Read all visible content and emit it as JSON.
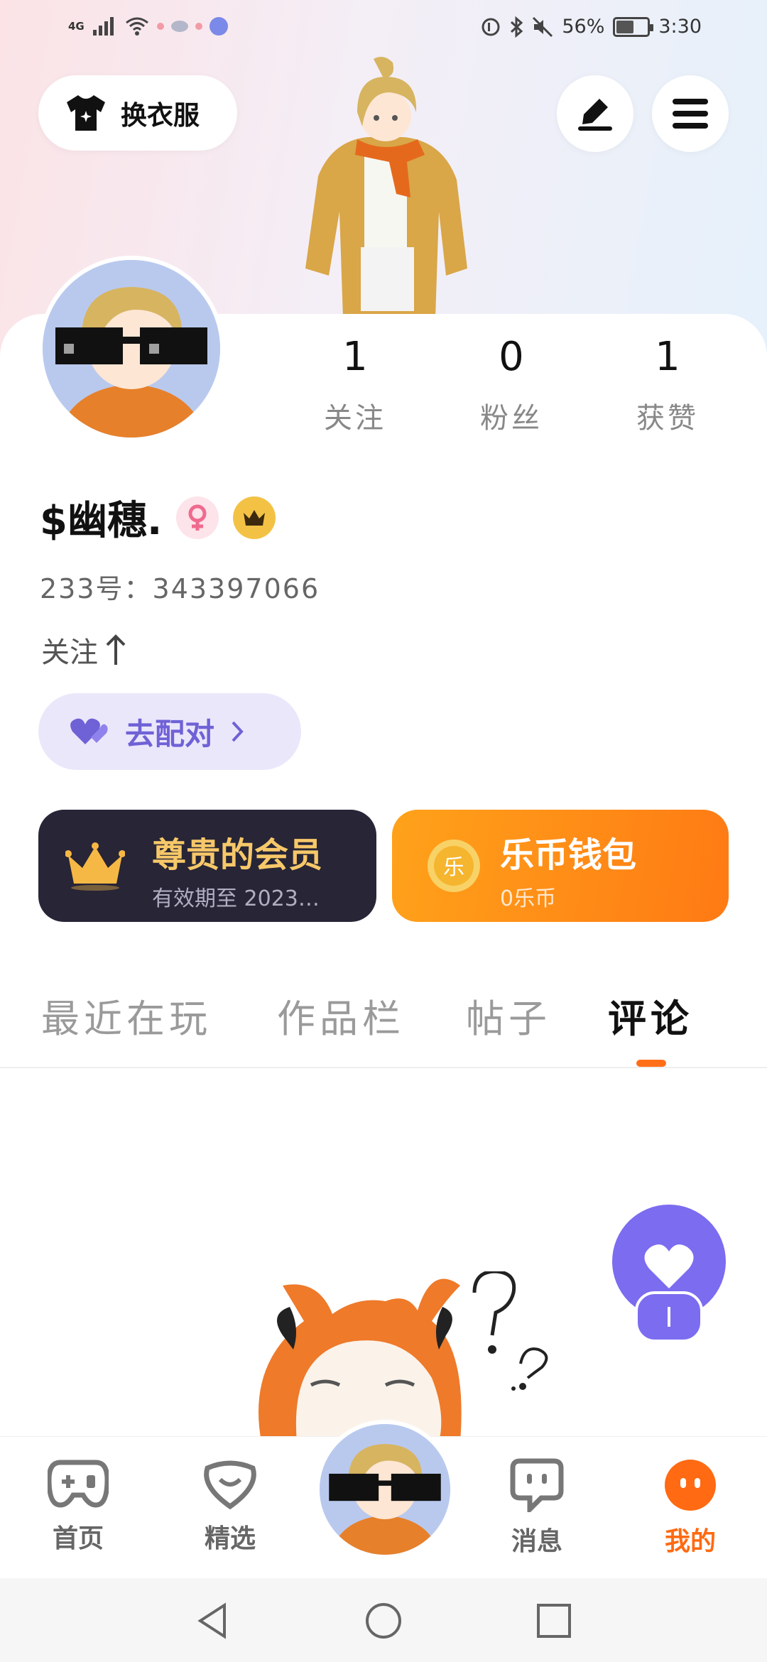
{
  "status_bar": {
    "network": "4G",
    "battery": "56%",
    "battery_level": 0.56,
    "time": "3:30"
  },
  "header": {
    "outfit_button_label": "换衣服",
    "icons": [
      "shirt-icon",
      "edit-icon",
      "menu-icon"
    ]
  },
  "profile": {
    "stats": [
      {
        "value": "1",
        "label": "关注"
      },
      {
        "value": "0",
        "label": "粉丝"
      },
      {
        "value": "1",
        "label": "获赞"
      }
    ],
    "username": "$幽穗.",
    "uid": "233号：343397066",
    "follow_link": "关注",
    "match_button": "去配对"
  },
  "cards": {
    "vip": {
      "title": "尊贵的会员",
      "subtitle": "有效期至 2023…"
    },
    "wallet": {
      "title": "乐币钱包",
      "subtitle": "0乐币",
      "coin_glyph": "乐"
    }
  },
  "tabs": {
    "items": [
      "最近在玩",
      "作品栏",
      "帖子",
      "评论"
    ],
    "active": "评论"
  },
  "colors": {
    "accent": "#ff6a12",
    "purple": "#7b6cf0",
    "vip_gold": "#f7c869"
  },
  "bottom_nav": {
    "items": [
      {
        "label": "首页",
        "icon": "gamepad-icon"
      },
      {
        "label": "精选",
        "icon": "heart-box-icon"
      },
      {
        "label": "消息",
        "icon": "message-icon"
      },
      {
        "label": "我的",
        "icon": "profile-face-icon"
      }
    ],
    "active": "我的"
  }
}
